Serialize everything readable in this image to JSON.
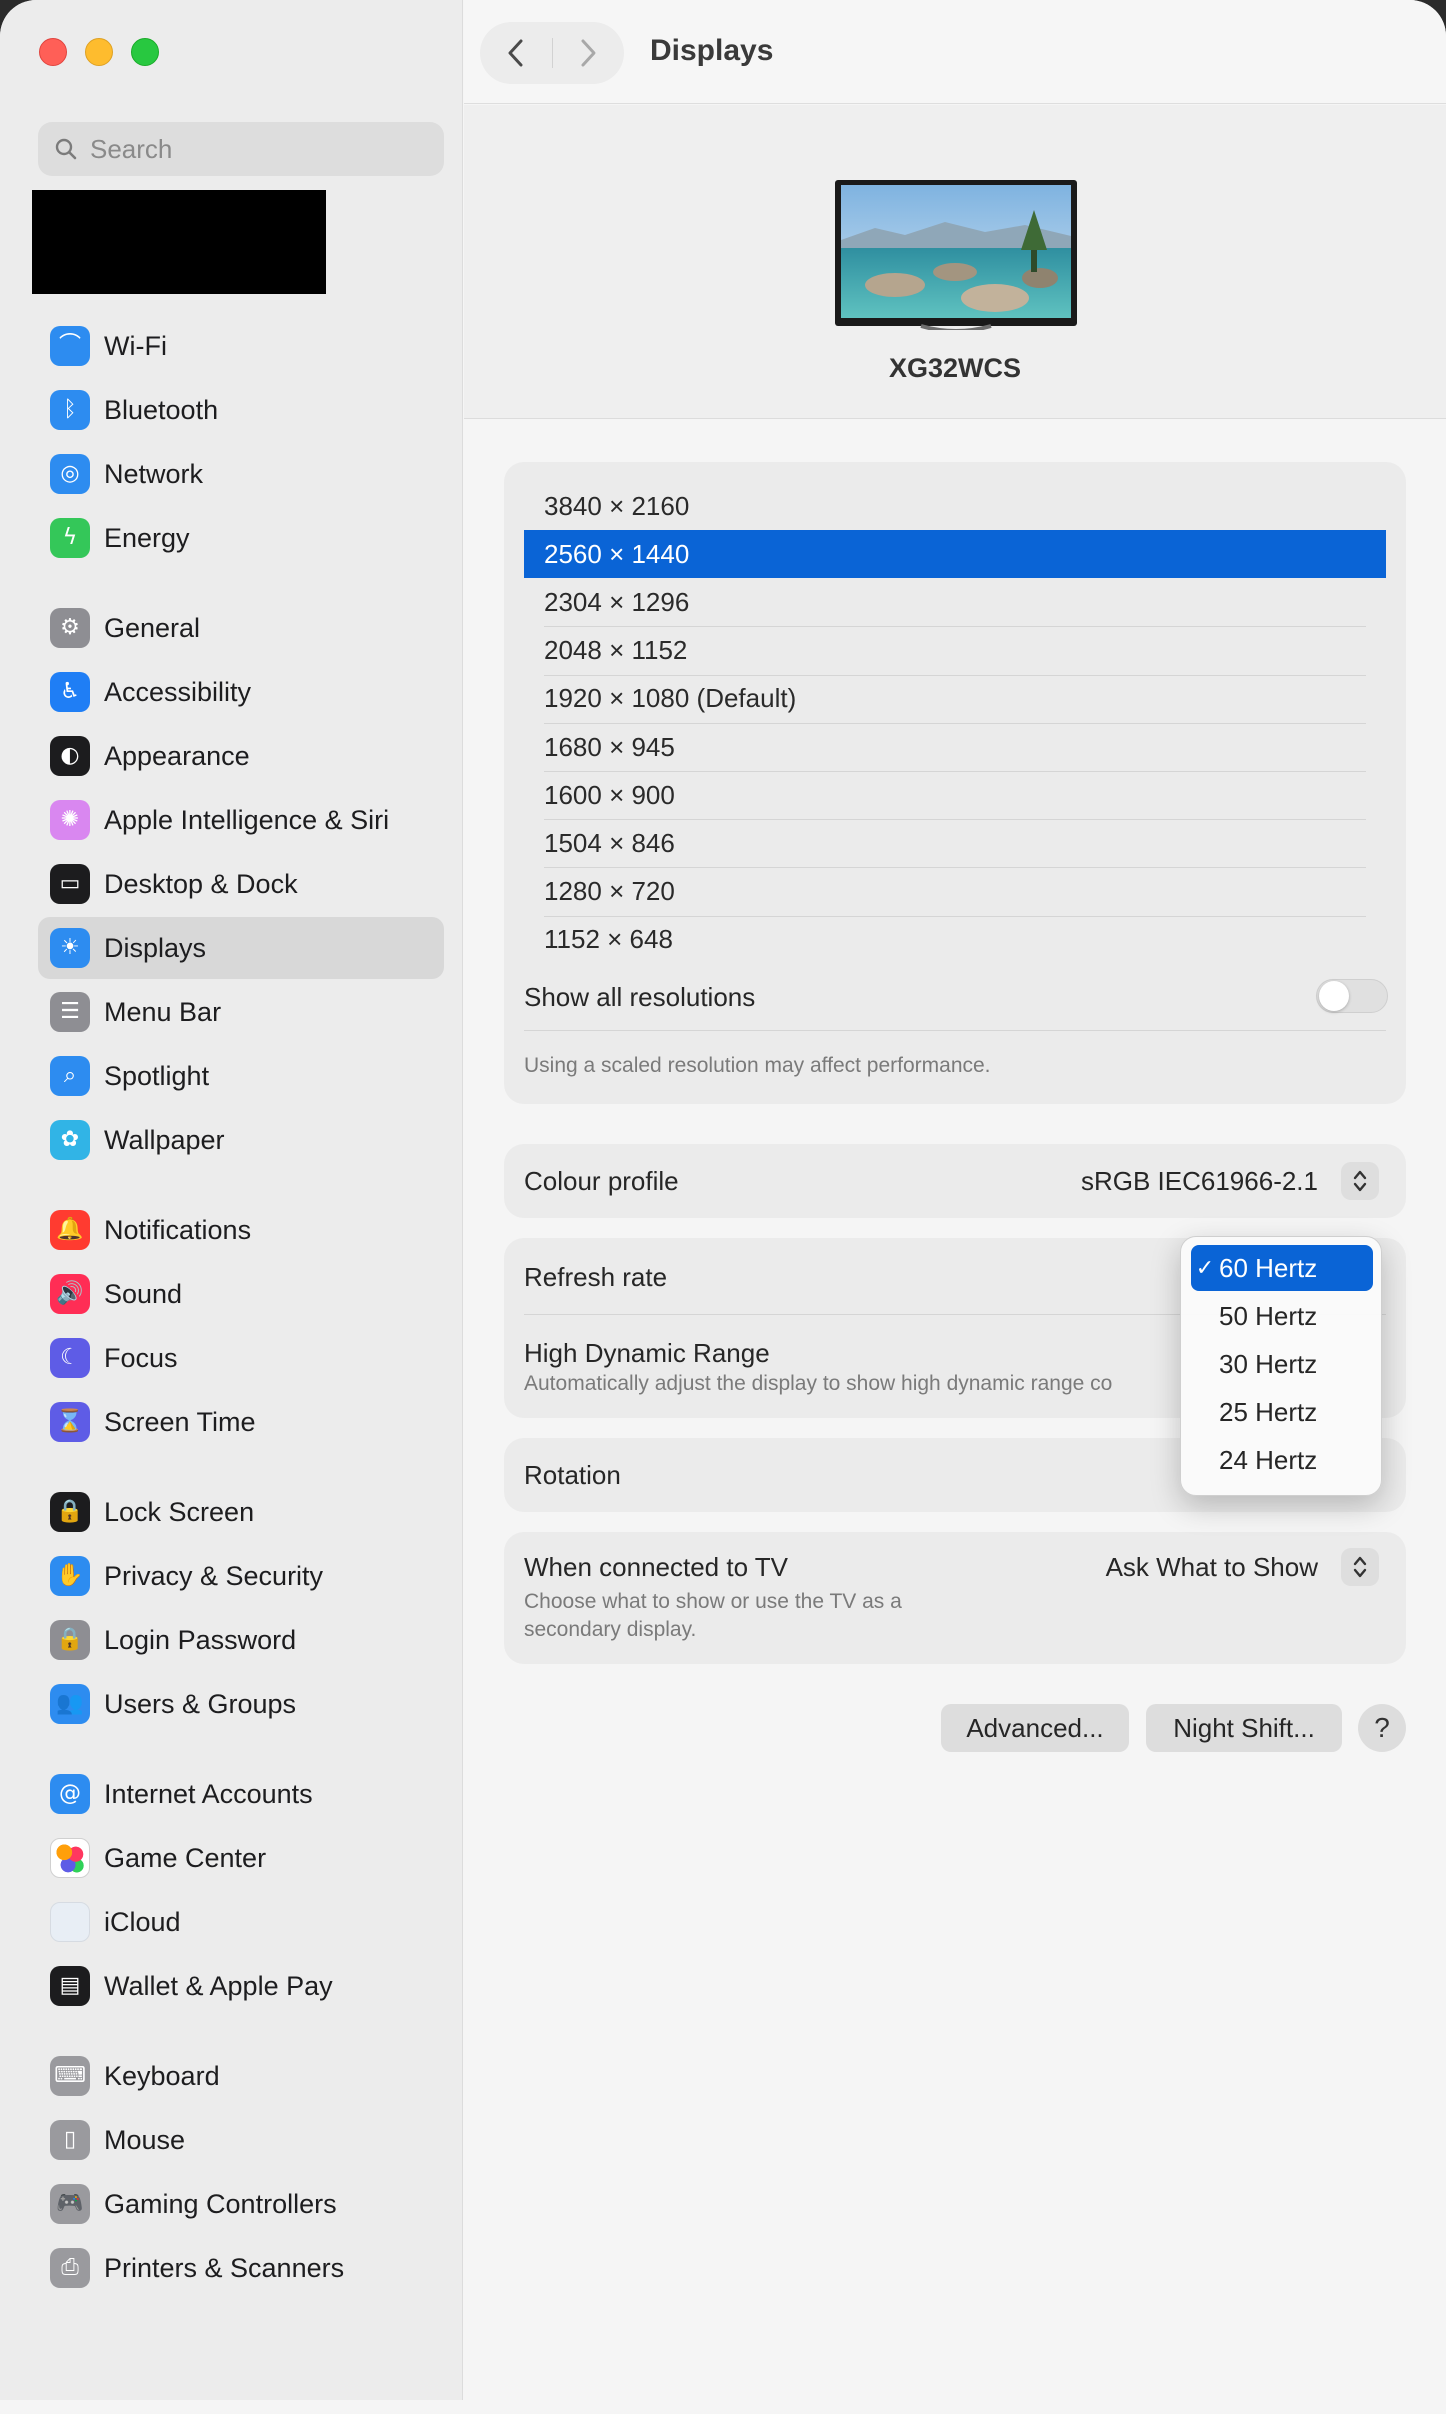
{
  "window": {
    "title": "Displays"
  },
  "search": {
    "placeholder": "Search"
  },
  "sidebar": {
    "items": [
      {
        "label": "Wi-Fi",
        "icon": "wifi-icon",
        "color": "#2d8cf0",
        "glyph": "⌒"
      },
      {
        "label": "Bluetooth",
        "icon": "bluetooth-icon",
        "color": "#2d8cf0",
        "glyph": "ᛒ"
      },
      {
        "label": "Network",
        "icon": "globe-icon",
        "color": "#2d8cf0",
        "glyph": "◎"
      },
      {
        "label": "Energy",
        "icon": "bolt-icon",
        "color": "#34c759",
        "glyph": "ϟ"
      },
      {
        "label": "General",
        "icon": "gear-icon",
        "color": "#8e8e93",
        "glyph": "⚙"
      },
      {
        "label": "Accessibility",
        "icon": "accessibility-icon",
        "color": "#1f7ef5",
        "glyph": "♿"
      },
      {
        "label": "Appearance",
        "icon": "appearance-icon",
        "color": "#1c1c1e",
        "glyph": "◐"
      },
      {
        "label": "Apple Intelligence & Siri",
        "icon": "siri-icon",
        "color": "#d987f0",
        "glyph": "✺"
      },
      {
        "label": "Desktop & Dock",
        "icon": "dock-icon",
        "color": "#1c1c1e",
        "glyph": "▭"
      },
      {
        "label": "Displays",
        "icon": "sun-icon",
        "color": "#2d8cf0",
        "glyph": "☀"
      },
      {
        "label": "Menu Bar",
        "icon": "menubar-icon",
        "color": "#8e8e93",
        "glyph": "☰"
      },
      {
        "label": "Spotlight",
        "icon": "magnifier-icon",
        "color": "#2d8cf0",
        "glyph": "⌕"
      },
      {
        "label": "Wallpaper",
        "icon": "flower-icon",
        "color": "#31b4e6",
        "glyph": "✿"
      },
      {
        "label": "Notifications",
        "icon": "bell-icon",
        "color": "#ff3b30",
        "glyph": "🔔"
      },
      {
        "label": "Sound",
        "icon": "speaker-icon",
        "color": "#ff2d55",
        "glyph": "🔊"
      },
      {
        "label": "Focus",
        "icon": "moon-icon",
        "color": "#5e5ce6",
        "glyph": "☾"
      },
      {
        "label": "Screen Time",
        "icon": "hourglass-icon",
        "color": "#5e5ce6",
        "glyph": "⌛"
      },
      {
        "label": "Lock Screen",
        "icon": "lock-screen-icon",
        "color": "#1c1c1e",
        "glyph": "🔒"
      },
      {
        "label": "Privacy & Security",
        "icon": "hand-icon",
        "color": "#2d8cf0",
        "glyph": "✋"
      },
      {
        "label": "Login Password",
        "icon": "lock-icon",
        "color": "#8e8e93",
        "glyph": "🔒"
      },
      {
        "label": "Users & Groups",
        "icon": "users-icon",
        "color": "#2d8cf0",
        "glyph": "👥"
      },
      {
        "label": "Internet Accounts",
        "icon": "at-icon",
        "color": "#2d8cf0",
        "glyph": "@"
      },
      {
        "label": "Game Center",
        "icon": "game-center-icon",
        "color": "#ffffff",
        "glyph": "●"
      },
      {
        "label": "iCloud",
        "icon": "icloud-icon",
        "color": "#e8eef5",
        "glyph": ""
      },
      {
        "label": "Wallet & Apple Pay",
        "icon": "wallet-icon",
        "color": "#1c1c1e",
        "glyph": "▤"
      },
      {
        "label": "Keyboard",
        "icon": "keyboard-icon",
        "color": "#9a9a9e",
        "glyph": "⌨"
      },
      {
        "label": "Mouse",
        "icon": "mouse-icon",
        "color": "#9a9a9e",
        "glyph": "▯"
      },
      {
        "label": "Gaming Controllers",
        "icon": "gamepad-icon",
        "color": "#9a9a9e",
        "glyph": "🎮"
      },
      {
        "label": "Printers & Scanners",
        "icon": "printer-icon",
        "color": "#9a9a9e",
        "glyph": "⎙"
      }
    ],
    "selected": "Displays"
  },
  "display": {
    "name": "XG32WCS"
  },
  "resolutions": {
    "options": [
      "3840 × 2160",
      "2560 × 1440",
      "2304 × 1296",
      "2048 × 1152",
      "1920 × 1080 (Default)",
      "1680 × 945",
      "1600 × 900",
      "1504 × 846",
      "1280 × 720",
      "1152 × 648"
    ],
    "selected_index": 1,
    "show_all_label": "Show all resolutions",
    "show_all_on": false,
    "note": "Using a scaled resolution may affect performance."
  },
  "colour_profile": {
    "label": "Colour profile",
    "value": "sRGB IEC61966-2.1"
  },
  "refresh_rate": {
    "label": "Refresh rate",
    "options": [
      "60 Hertz",
      "50 Hertz",
      "30 Hertz",
      "25 Hertz",
      "24 Hertz"
    ],
    "selected_index": 0,
    "check": "✓"
  },
  "hdr": {
    "label": "High Dynamic Range",
    "description": "Automatically adjust the display to show high dynamic range co"
  },
  "rotation": {
    "label": "Rotation"
  },
  "tv": {
    "label": "When connected to TV",
    "description_line1": "Choose what to show or use the TV as a",
    "description_line2": "secondary display.",
    "value": "Ask What to Show"
  },
  "buttons": {
    "advanced": "Advanced...",
    "night_shift": "Night Shift...",
    "help": "?"
  },
  "colors": {
    "accent": "#0a64d6",
    "sidebar_bg": "#ececec",
    "content_bg": "#f5f5f5"
  }
}
